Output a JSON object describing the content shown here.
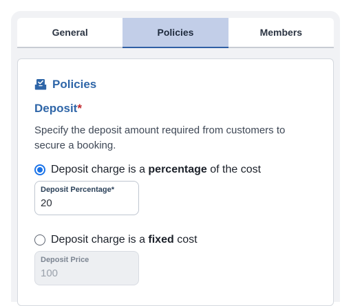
{
  "tabs": [
    {
      "label": "General",
      "active": false
    },
    {
      "label": "Policies",
      "active": true
    },
    {
      "label": "Members",
      "active": false
    }
  ],
  "section": {
    "icon": "inbox-tray-icon",
    "title": "Policies"
  },
  "deposit": {
    "heading": "Deposit",
    "required_marker": "*",
    "description": "Specify the deposit amount required from customers to secure a booking.",
    "options": [
      {
        "selected": true,
        "text_before": "Deposit charge is a ",
        "text_bold": "percentage",
        "text_after": " of the cost",
        "field": {
          "label": "Deposit Percentage*",
          "value": "20",
          "disabled": false
        }
      },
      {
        "selected": false,
        "text_before": "Deposit charge is a ",
        "text_bold": "fixed",
        "text_after": " cost",
        "field": {
          "label": "Deposit Price",
          "value": "100",
          "disabled": true
        }
      }
    ]
  },
  "colors": {
    "accent": "#2f66a8",
    "active_tab_bg": "#c2cee8",
    "radio_selected": "#1a73e8",
    "required": "#c0272d"
  }
}
